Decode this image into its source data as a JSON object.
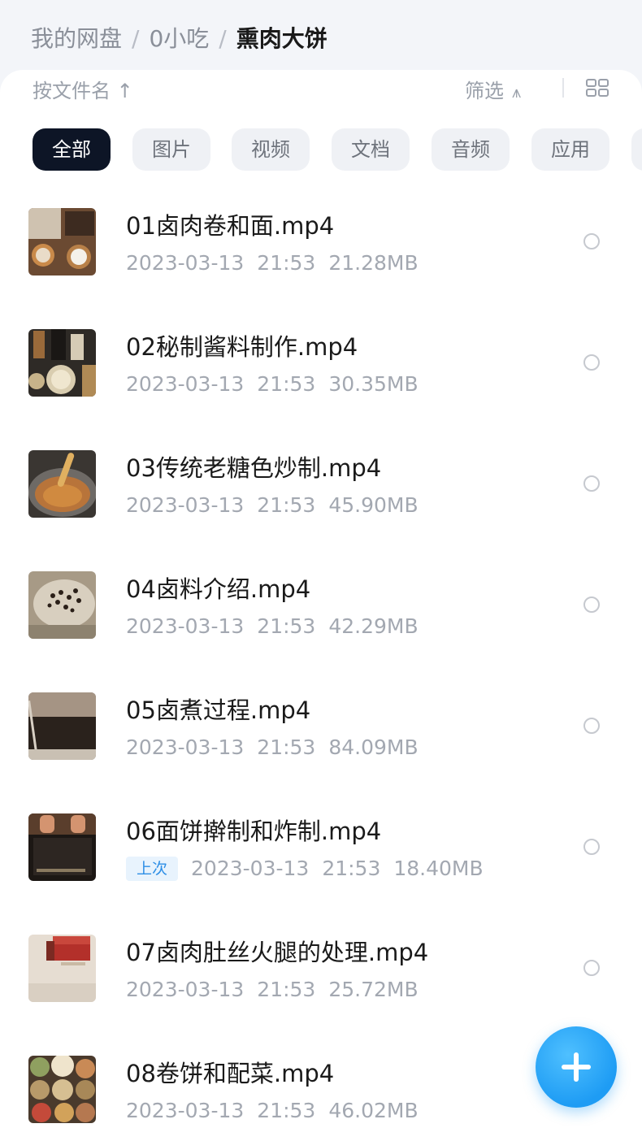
{
  "breadcrumb": {
    "root": "我的网盘",
    "parent": "0小吃",
    "current": "熏肉大饼"
  },
  "toolbar": {
    "sort_label": "按文件名 ↑",
    "filter_label": "筛选"
  },
  "filters": [
    "全部",
    "图片",
    "视频",
    "文档",
    "音频",
    "应用"
  ],
  "files": [
    {
      "name": "01卤肉卷和面.mp4",
      "date": "2023-03-13",
      "time": "21:53",
      "size": "21.28MB",
      "tag": ""
    },
    {
      "name": "02秘制酱料制作.mp4",
      "date": "2023-03-13",
      "time": "21:53",
      "size": "30.35MB",
      "tag": ""
    },
    {
      "name": "03传统老糖色炒制.mp4",
      "date": "2023-03-13",
      "time": "21:53",
      "size": "45.90MB",
      "tag": ""
    },
    {
      "name": "04卤料介绍.mp4",
      "date": "2023-03-13",
      "time": "21:53",
      "size": "42.29MB",
      "tag": ""
    },
    {
      "name": "05卤煮过程.mp4",
      "date": "2023-03-13",
      "time": "21:53",
      "size": "84.09MB",
      "tag": ""
    },
    {
      "name": "06面饼擀制和炸制.mp4",
      "date": "2023-03-13",
      "time": "21:53",
      "size": "18.40MB",
      "tag": "上次"
    },
    {
      "name": "07卤肉肚丝火腿的处理.mp4",
      "date": "2023-03-13",
      "time": "21:53",
      "size": "25.72MB",
      "tag": ""
    },
    {
      "name": "08卷饼和配菜.mp4",
      "date": "2023-03-13",
      "time": "21:53",
      "size": "46.02MB",
      "tag": ""
    }
  ],
  "colors": {
    "accent": "#1e9cf4",
    "active_chip": "#0d1526",
    "tag_bg": "#e8f3fd",
    "tag_text": "#2d8ee6"
  }
}
